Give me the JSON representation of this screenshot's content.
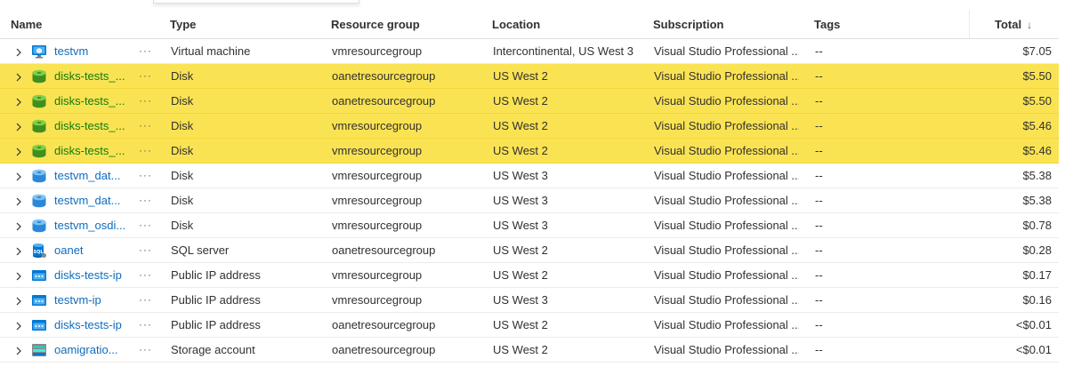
{
  "columns": {
    "name": "Name",
    "type": "Type",
    "resource_group": "Resource group",
    "location": "Location",
    "subscription": "Subscription",
    "tags": "Tags",
    "total": "Total",
    "sort_glyph": "↓"
  },
  "more_glyph": "···",
  "rows": [
    {
      "name": "testvm",
      "icon": "virtual-machine-icon",
      "type": "Virtual machine",
      "resource_group": "vmresourcegroup",
      "location": "Intercontinental, US West 3",
      "subscription": "Visual Studio Professional ...",
      "tags": "--",
      "total": "$7.05",
      "highlighted": false
    },
    {
      "name": "disks-tests_...",
      "icon": "disk-icon",
      "type": "Disk",
      "resource_group": "oanetresourcegroup",
      "location": "US West 2",
      "subscription": "Visual Studio Professional ...",
      "tags": "--",
      "total": "$5.50",
      "highlighted": true
    },
    {
      "name": "disks-tests_...",
      "icon": "disk-icon",
      "type": "Disk",
      "resource_group": "oanetresourcegroup",
      "location": "US West 2",
      "subscription": "Visual Studio Professional ...",
      "tags": "--",
      "total": "$5.50",
      "highlighted": true
    },
    {
      "name": "disks-tests_...",
      "icon": "disk-icon",
      "type": "Disk",
      "resource_group": "vmresourcegroup",
      "location": "US West 2",
      "subscription": "Visual Studio Professional ...",
      "tags": "--",
      "total": "$5.46",
      "highlighted": true
    },
    {
      "name": "disks-tests_...",
      "icon": "disk-icon",
      "type": "Disk",
      "resource_group": "vmresourcegroup",
      "location": "US West 2",
      "subscription": "Visual Studio Professional ...",
      "tags": "--",
      "total": "$5.46",
      "highlighted": true
    },
    {
      "name": "testvm_dat...",
      "icon": "disk-icon",
      "type": "Disk",
      "resource_group": "vmresourcegroup",
      "location": "US West 3",
      "subscription": "Visual Studio Professional ...",
      "tags": "--",
      "total": "$5.38",
      "highlighted": false
    },
    {
      "name": "testvm_dat...",
      "icon": "disk-icon",
      "type": "Disk",
      "resource_group": "vmresourcegroup",
      "location": "US West 3",
      "subscription": "Visual Studio Professional ...",
      "tags": "--",
      "total": "$5.38",
      "highlighted": false
    },
    {
      "name": "testvm_osdi...",
      "icon": "disk-icon",
      "type": "Disk",
      "resource_group": "vmresourcegroup",
      "location": "US West 3",
      "subscription": "Visual Studio Professional ...",
      "tags": "--",
      "total": "$0.78",
      "highlighted": false
    },
    {
      "name": "oanet",
      "icon": "sql-server-icon",
      "type": "SQL server",
      "resource_group": "oanetresourcegroup",
      "location": "US West 2",
      "subscription": "Visual Studio Professional ...",
      "tags": "--",
      "total": "$0.28",
      "highlighted": false
    },
    {
      "name": "disks-tests-ip",
      "icon": "public-ip-icon",
      "type": "Public IP address",
      "resource_group": "vmresourcegroup",
      "location": "US West 2",
      "subscription": "Visual Studio Professional ...",
      "tags": "--",
      "total": "$0.17",
      "highlighted": false
    },
    {
      "name": "testvm-ip",
      "icon": "public-ip-icon",
      "type": "Public IP address",
      "resource_group": "vmresourcegroup",
      "location": "US West 3",
      "subscription": "Visual Studio Professional ...",
      "tags": "--",
      "total": "$0.16",
      "highlighted": false
    },
    {
      "name": "disks-tests-ip",
      "icon": "public-ip-icon",
      "type": "Public IP address",
      "resource_group": "oanetresourcegroup",
      "location": "US West 2",
      "subscription": "Visual Studio Professional ...",
      "tags": "--",
      "total": "<$0.01",
      "highlighted": false
    },
    {
      "name": "oamigratio...",
      "icon": "storage-account-icon",
      "type": "Storage account",
      "resource_group": "oanetresourcegroup",
      "location": "US West 2",
      "subscription": "Visual Studio Professional ...",
      "tags": "--",
      "total": "<$0.01",
      "highlighted": false
    }
  ],
  "colors": {
    "highlight": "#fae353",
    "link": "#0f6cbd",
    "highlight_link": "#107c10",
    "disk_green": "#3f8f1f",
    "disk_blue": "#2b88d8"
  }
}
